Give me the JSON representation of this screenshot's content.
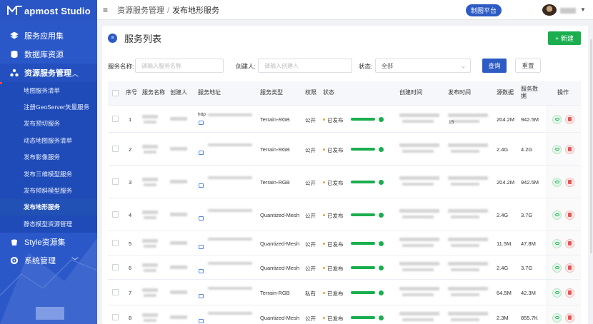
{
  "app": {
    "name": "apmost Studio"
  },
  "sidebar": {
    "menus": [
      {
        "label": "服务应用集",
        "icon": "layers-icon"
      },
      {
        "label": "数据库资源",
        "icon": "database-icon"
      },
      {
        "label": "资源服务管理",
        "icon": "cluster-icon",
        "expanded": true
      },
      {
        "label": "Style资源集",
        "icon": "bucket-icon"
      },
      {
        "label": "系统管理",
        "icon": "gear-icon"
      }
    ],
    "submenu": [
      "地图服务清单",
      "注册GeoServer矢量服务",
      "发布预切服务",
      "动态地图服务清单",
      "发布影像服务",
      "发布三维模型服务",
      "发布倾斜模型服务",
      "发布地形服务",
      "静态模型资源管理"
    ],
    "active_sub": 7
  },
  "header": {
    "breadcrumb": [
      "资源服务管理",
      "发布地形服务"
    ],
    "separator": "/",
    "platform_button": "制图平台"
  },
  "card": {
    "title": "服务列表",
    "new_button": "+ 新建"
  },
  "filters": {
    "name_label": "服务名称:",
    "name_placeholder": "请输入服务名称",
    "creator_label": "创建人:",
    "creator_placeholder": "请输入创建人",
    "status_label": "状态:",
    "status_value": "全部",
    "query_button": "查询",
    "reset_button": "重置"
  },
  "table": {
    "headers": {
      "index": "序号",
      "name": "服务名称",
      "creator": "创建人",
      "address": "服务地址",
      "type": "服务类型",
      "permission": "权限",
      "status": "状态",
      "created": "创建时间",
      "published": "发布时间",
      "source_data": "源数据",
      "service_data": "服务数据",
      "actions": "操作"
    },
    "rows": [
      {
        "index": "1",
        "address_prefix": "http",
        "type": "Terrain-RGB",
        "permission": "公开",
        "status": "已发布",
        "published_suffix": "15",
        "source": "204.2M",
        "service": "942.5M"
      },
      {
        "index": "2",
        "address_prefix": "",
        "type": "Terrain-RGB",
        "permission": "公开",
        "status": "已发布",
        "published_suffix": "",
        "source": "2.4G",
        "service": "4.2G"
      },
      {
        "index": "3",
        "address_prefix": "",
        "type": "Terrain-RGB",
        "permission": "公开",
        "status": "已发布",
        "published_suffix": "",
        "source": "204.2M",
        "service": "942.5M"
      },
      {
        "index": "4",
        "address_prefix": "",
        "type": "Quantized-Mesh",
        "permission": "公开",
        "status": "已发布",
        "published_suffix": "",
        "source": "2.4G",
        "service": "3.7G"
      },
      {
        "index": "5",
        "address_prefix": "",
        "type": "Quantized-Mesh",
        "permission": "公开",
        "status": "已发布",
        "published_suffix": "",
        "source": "11.5M",
        "service": "47.8M"
      },
      {
        "index": "6",
        "address_prefix": "",
        "type": "Quantized-Mesh",
        "permission": "公开",
        "status": "已发布",
        "published_suffix": "",
        "source": "2.4G",
        "service": "3.7G"
      },
      {
        "index": "7",
        "address_prefix": "",
        "type": "Terrain-RGB",
        "permission": "私有",
        "status": "已发布",
        "published_suffix": "",
        "source": "64.5M",
        "service": "42.3M"
      },
      {
        "index": "8",
        "address_prefix": "",
        "type": "Quantized-Mesh",
        "permission": "公开",
        "status": "已发布",
        "published_suffix": "",
        "source": "2.3M",
        "service": "855.7K"
      }
    ]
  },
  "colors": {
    "sidebar": "#2b58c9",
    "primary": "#2d5bc4",
    "success": "#1aae4f",
    "danger": "#e45656"
  }
}
